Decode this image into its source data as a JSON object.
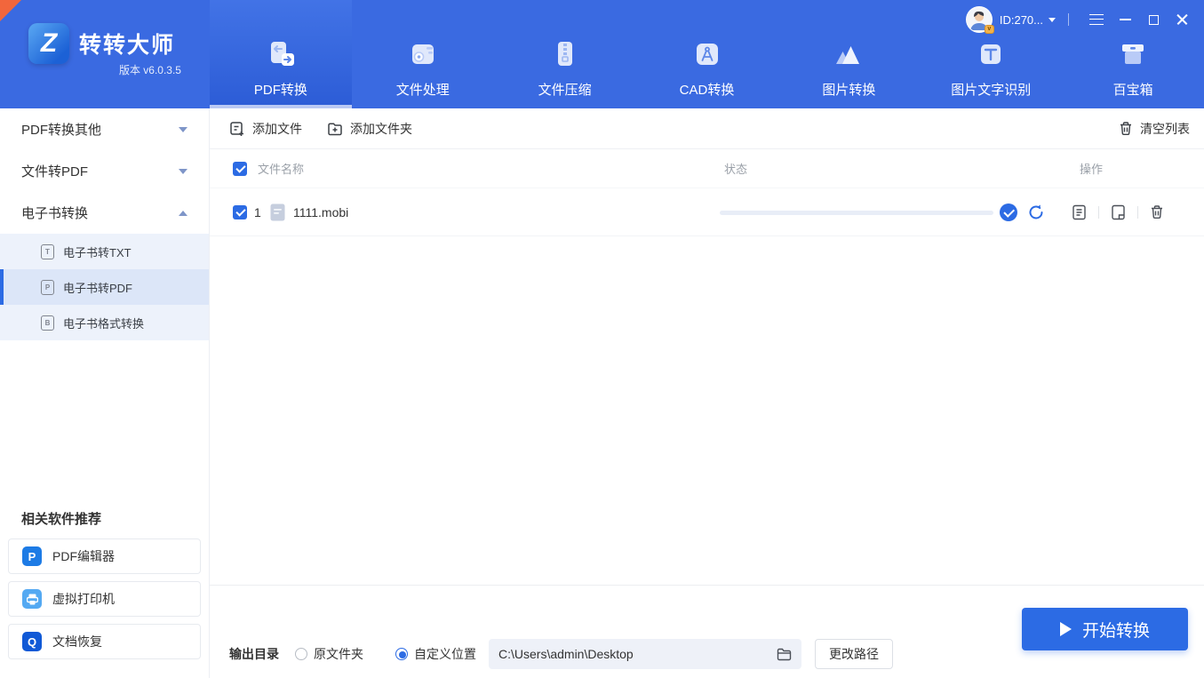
{
  "app": {
    "brand": "转转大师",
    "version": "版本 v6.0.3.5",
    "logo_glyph": "Z",
    "corner_ribbon_color": "#f2663c"
  },
  "titlebar": {
    "user_id": "ID:270...",
    "icons": [
      "user-avatar",
      "dropdown-caret",
      "menu-icon",
      "minimize-icon",
      "maximize-icon",
      "close-icon"
    ]
  },
  "nav": {
    "tabs": [
      {
        "label": "PDF转换",
        "icon": "pdf-convert-icon",
        "active": true
      },
      {
        "label": "文件处理",
        "icon": "file-process-icon",
        "active": false
      },
      {
        "label": "文件压缩",
        "icon": "file-compress-icon",
        "active": false
      },
      {
        "label": "CAD转换",
        "icon": "cad-convert-icon",
        "active": false
      },
      {
        "label": "图片转换",
        "icon": "image-convert-icon",
        "active": false
      },
      {
        "label": "图片文字识别",
        "icon": "ocr-icon",
        "active": false
      },
      {
        "label": "百宝箱",
        "icon": "toolbox-icon",
        "active": false
      }
    ]
  },
  "sidebar": {
    "groups": [
      {
        "label": "PDF转换其他",
        "expanded": false
      },
      {
        "label": "文件转PDF",
        "expanded": false
      },
      {
        "label": "电子书转换",
        "expanded": true
      }
    ],
    "sub_items": [
      {
        "label": "电子书转TXT",
        "badge": "T",
        "selected": false
      },
      {
        "label": "电子书转PDF",
        "badge": "P",
        "selected": true
      },
      {
        "label": "电子书格式转换",
        "badge": "B",
        "selected": false
      }
    ],
    "recommend": {
      "title": "相关软件推荐",
      "items": [
        {
          "label": "PDF编辑器",
          "icon": "pdf-editor-icon",
          "glyph": "P",
          "color": "#1d7be5"
        },
        {
          "label": "虚拟打印机",
          "icon": "virtual-printer-icon",
          "glyph": "",
          "color": "#54a9f2"
        },
        {
          "label": "文档恢复",
          "icon": "doc-recovery-icon",
          "glyph": "Q",
          "color": "#1059d6"
        }
      ]
    }
  },
  "toolbar": {
    "add_file": "添加文件",
    "add_folder": "添加文件夹",
    "clear_list": "清空列表"
  },
  "file_table": {
    "columns": {
      "name": "文件名称",
      "status": "状态",
      "actions": "操作"
    },
    "rows": [
      {
        "index": "1",
        "name": "1111.mobi",
        "progress_percent": 100,
        "status": "completed",
        "actions": [
          "view-document-icon",
          "open-location-icon",
          "delete-icon"
        ],
        "extra": [
          "status-check-icon",
          "refresh-icon"
        ]
      }
    ]
  },
  "footer": {
    "output_label": "输出目录",
    "options": [
      {
        "label": "原文件夹",
        "selected": false
      },
      {
        "label": "自定义位置",
        "selected": true
      }
    ],
    "path_value": "C:\\Users\\admin\\Desktop",
    "change_path_label": "更改路径",
    "start_label": "开始转换"
  },
  "colors": {
    "primary": "#2c6be4",
    "header_bg": "#3a6ae1",
    "active_tab_indicator": "#bac9f3",
    "subnav_bg": "#edf2fb"
  }
}
